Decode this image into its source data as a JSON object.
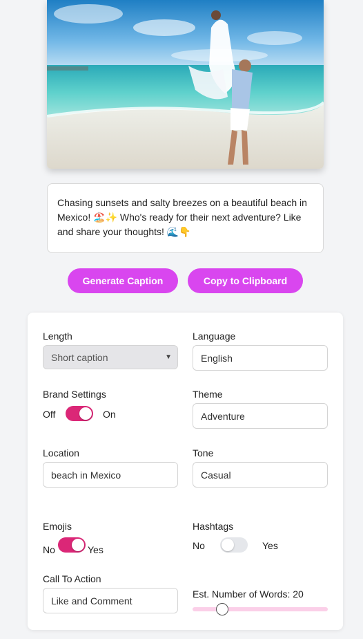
{
  "caption": {
    "text": "Chasing sunsets and salty breezes on a beautiful beach in Mexico! 🏖️✨ Who's ready for their next adventure? Like and share your thoughts! 🌊👇"
  },
  "buttons": {
    "generate": "Generate Caption",
    "copy": "Copy to Clipboard"
  },
  "settings": {
    "length": {
      "label": "Length",
      "value": "Short caption"
    },
    "language": {
      "label": "Language",
      "value": "English"
    },
    "brand": {
      "label": "Brand Settings",
      "off": "Off",
      "on": "On",
      "enabled": true
    },
    "theme": {
      "label": "Theme",
      "value": "Adventure"
    },
    "location": {
      "label": "Location",
      "value": "beach in Mexico"
    },
    "tone": {
      "label": "Tone",
      "value": "Casual"
    },
    "emojis": {
      "label": "Emojis",
      "no": "No",
      "yes": "Yes",
      "enabled": true
    },
    "hashtags": {
      "label": "Hashtags",
      "no": "No",
      "yes": "Yes",
      "enabled": false
    },
    "cta": {
      "label": "Call To Action",
      "value": "Like and Comment"
    },
    "words": {
      "label": "Est. Number of Words: 20",
      "value": 20,
      "fraction": 0.22
    }
  },
  "colors": {
    "accent": "#d946ef",
    "toggle_on": "#db2777",
    "slider_track": "#fbcfe8"
  }
}
